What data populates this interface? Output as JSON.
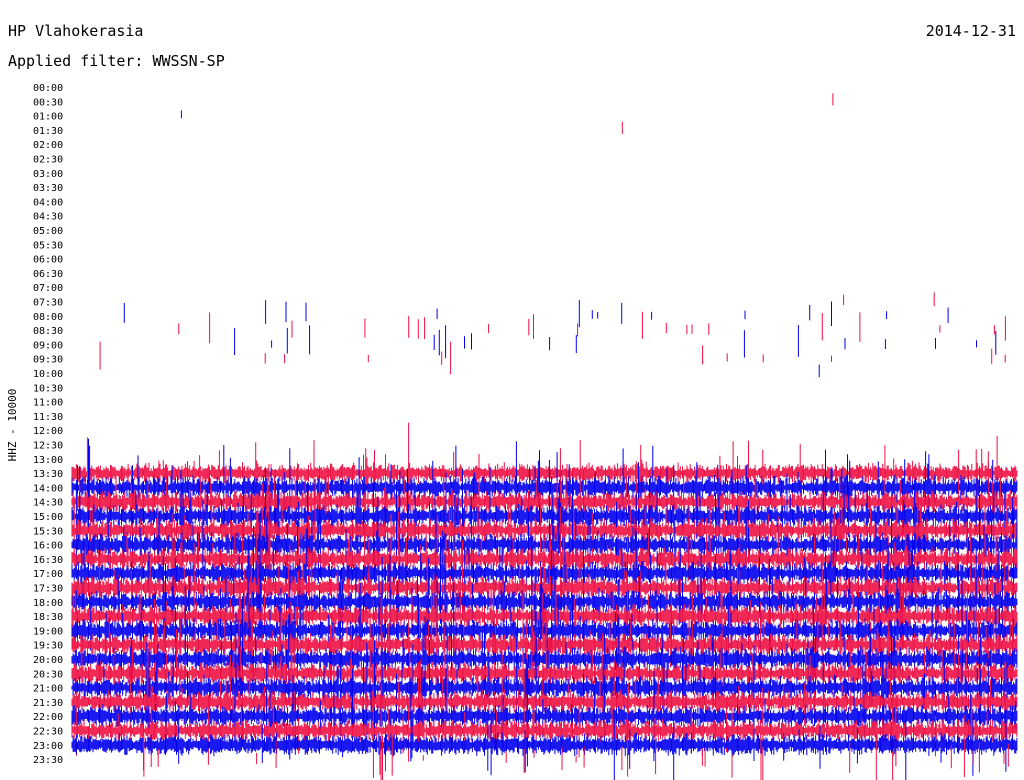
{
  "station": "HP Vlahokerasia",
  "date": "2014-12-31",
  "filter_label": "Applied filter: WWSSN-SP",
  "colors": {
    "trace_a": "#0000ee",
    "trace_b": "#ee1144",
    "background": "#ffffff",
    "text": "#000000"
  },
  "chart_data": {
    "type": "line",
    "title": "HP Vlahokerasia",
    "subtitle": "Applied filter: WWSSN-SP",
    "ylabel": "HHZ - 10000",
    "xlabel": "",
    "y_tick_labels": [
      "00:00",
      "00:30",
      "01:00",
      "01:30",
      "02:00",
      "02:30",
      "03:00",
      "03:30",
      "04:00",
      "04:30",
      "05:00",
      "05:30",
      "06:00",
      "06:30",
      "07:00",
      "07:30",
      "08:00",
      "08:30",
      "09:00",
      "09:30",
      "10:00",
      "10:30",
      "11:00",
      "11:30",
      "12:00",
      "12:30",
      "13:00",
      "13:30",
      "14:00",
      "14:30",
      "15:00",
      "15:30",
      "16:00",
      "16:30",
      "17:00",
      "17:30",
      "18:00",
      "18:30",
      "19:00",
      "19:30",
      "20:00",
      "20:30",
      "21:00",
      "21:30",
      "22:00",
      "22:30",
      "23:00",
      "23:30"
    ],
    "series_colors_alternating": [
      "#0000ee",
      "#ee1144"
    ],
    "x_range_minutes": [
      0,
      30
    ],
    "grid": false,
    "legend": "none",
    "row_activity": [
      0.0,
      0.02,
      0.02,
      0.02,
      0.0,
      0.0,
      0.0,
      0.0,
      0.0,
      0.0,
      0.0,
      0.0,
      0.0,
      0.0,
      0.0,
      0.1,
      0.25,
      0.35,
      0.3,
      0.2,
      0.1,
      0.0,
      0.0,
      0.0,
      0.0,
      0.0,
      0.0,
      0.85,
      0.9,
      0.95,
      1.0,
      1.0,
      1.0,
      1.0,
      1.0,
      1.0,
      1.0,
      1.0,
      1.0,
      1.0,
      1.0,
      0.95,
      0.85,
      0.75,
      0.65,
      0.55,
      0.5,
      0.45
    ],
    "row_amplitude": [
      0.0,
      0.5,
      0.5,
      0.5,
      0.0,
      0.0,
      0.0,
      0.0,
      0.0,
      0.0,
      0.0,
      0.0,
      0.0,
      0.0,
      0.0,
      0.4,
      0.6,
      0.7,
      0.8,
      0.7,
      0.5,
      0.0,
      0.0,
      0.0,
      0.0,
      0.0,
      0.0,
      0.9,
      1.0,
      1.0,
      1.0,
      1.0,
      1.0,
      1.0,
      1.0,
      1.0,
      1.0,
      1.0,
      1.0,
      1.0,
      1.0,
      1.0,
      1.0,
      1.0,
      1.0,
      1.0,
      1.0,
      1.0
    ]
  }
}
